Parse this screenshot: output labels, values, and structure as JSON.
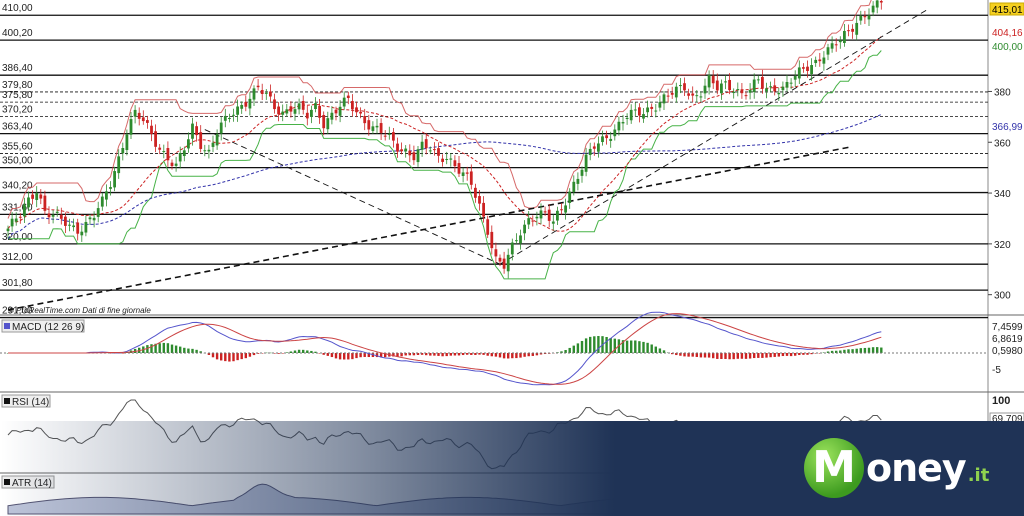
{
  "chart_data": {
    "type": "candlestick",
    "watermark": "© ProRealTime.com Dati di fine giornale",
    "colors": {
      "up": "#2e8b2e",
      "down": "#cc2222",
      "sma_short": "#cc2222",
      "sma_long": "#3333aa",
      "stop_red": "#cc4444",
      "stop_green": "#33aa33",
      "macd": "#5555cc",
      "macd_signal": "#cc4444",
      "rsi": "#555555",
      "atr": "#444466"
    },
    "price_axis": {
      "ticks": [
        300,
        320,
        340,
        360,
        380
      ],
      "range": [
        292,
        416
      ]
    },
    "support_resistance_levels": [
      {
        "value": "410,00",
        "style": "solid"
      },
      {
        "value": "400,20",
        "style": "solid"
      },
      {
        "value": "386,40",
        "style": "solid"
      },
      {
        "value": "379,80",
        "style": "dashed"
      },
      {
        "value": "375,80",
        "style": "dashed"
      },
      {
        "value": "370,20",
        "style": "dashed"
      },
      {
        "value": "363,40",
        "style": "solid"
      },
      {
        "value": "355,60",
        "style": "dashed"
      },
      {
        "value": "350,00",
        "style": "solid"
      },
      {
        "value": "340,20",
        "style": "solid"
      },
      {
        "value": "331,60",
        "style": "solid"
      },
      {
        "value": "320,00",
        "style": "solid"
      },
      {
        "value": "312,00",
        "style": "solid"
      },
      {
        "value": "301,80",
        "style": "solid"
      },
      {
        "value": "291,00",
        "style": "solid"
      }
    ],
    "right_tags": [
      {
        "text": "415,01",
        "color": "#000000",
        "bg": "#f5d020"
      },
      {
        "text": "404,16",
        "color": "#cc2222",
        "bg": "#ffffff"
      },
      {
        "text": "400,00",
        "color": "#2e8b2e",
        "bg": "#ffffff"
      },
      {
        "text": "366,99",
        "color": "#3333aa",
        "bg": "#ffffff"
      }
    ],
    "close_anchors": [
      [
        0,
        326
      ],
      [
        3,
        331
      ],
      [
        5,
        337
      ],
      [
        7,
        342
      ],
      [
        9,
        333
      ],
      [
        12,
        330
      ],
      [
        15,
        327
      ],
      [
        17,
        326
      ],
      [
        19,
        328
      ],
      [
        21,
        331
      ],
      [
        23,
        336
      ],
      [
        25,
        344
      ],
      [
        27,
        354
      ],
      [
        29,
        365
      ],
      [
        31,
        371
      ],
      [
        33,
        368
      ],
      [
        35,
        363
      ],
      [
        37,
        358
      ],
      [
        39,
        354
      ],
      [
        41,
        350
      ],
      [
        43,
        357
      ],
      [
        45,
        366
      ],
      [
        47,
        360
      ],
      [
        49,
        356
      ],
      [
        51,
        364
      ],
      [
        53,
        368
      ],
      [
        55,
        372
      ],
      [
        57,
        375
      ],
      [
        59,
        378
      ],
      [
        61,
        381
      ],
      [
        63,
        378
      ],
      [
        65,
        374
      ],
      [
        67,
        372
      ],
      [
        69,
        374
      ],
      [
        71,
        373
      ],
      [
        73,
        370
      ],
      [
        75,
        374
      ],
      [
        77,
        368
      ],
      [
        79,
        371
      ],
      [
        81,
        374
      ],
      [
        83,
        376
      ],
      [
        85,
        372
      ],
      [
        87,
        369
      ],
      [
        89,
        366
      ],
      [
        91,
        364
      ],
      [
        93,
        361
      ],
      [
        95,
        358
      ],
      [
        97,
        357
      ],
      [
        99,
        355
      ],
      [
        101,
        358
      ],
      [
        103,
        357
      ],
      [
        105,
        354
      ],
      [
        107,
        355
      ],
      [
        109,
        351
      ],
      [
        111,
        347
      ],
      [
        113,
        343
      ],
      [
        115,
        335
      ],
      [
        117,
        326
      ],
      [
        119,
        314
      ],
      [
        121,
        311
      ],
      [
        123,
        318
      ],
      [
        125,
        325
      ],
      [
        127,
        330
      ],
      [
        129,
        332
      ],
      [
        131,
        331
      ],
      [
        133,
        328
      ],
      [
        135,
        334
      ],
      [
        137,
        341
      ],
      [
        139,
        347
      ],
      [
        141,
        353
      ],
      [
        143,
        358
      ],
      [
        145,
        361
      ],
      [
        147,
        364
      ],
      [
        149,
        367
      ],
      [
        151,
        370
      ],
      [
        153,
        371
      ],
      [
        155,
        372
      ],
      [
        157,
        374
      ],
      [
        159,
        376
      ],
      [
        161,
        378
      ],
      [
        163,
        380
      ],
      [
        165,
        382
      ],
      [
        167,
        378
      ],
      [
        169,
        380
      ],
      [
        171,
        384
      ],
      [
        173,
        381
      ],
      [
        175,
        383
      ],
      [
        177,
        382
      ],
      [
        179,
        379
      ],
      [
        181,
        380
      ],
      [
        183,
        384
      ],
      [
        185,
        381
      ],
      [
        187,
        382
      ],
      [
        189,
        381
      ],
      [
        191,
        384
      ],
      [
        193,
        387
      ],
      [
        195,
        390
      ],
      [
        197,
        392
      ],
      [
        199,
        395
      ],
      [
        201,
        397
      ],
      [
        203,
        400
      ],
      [
        205,
        404
      ],
      [
        207,
        408
      ],
      [
        209,
        410
      ],
      [
        211,
        412
      ],
      [
        213,
        415.01
      ]
    ],
    "trend_lines": [
      {
        "from": [
          0,
          294
        ],
        "to": [
          205,
          358
        ],
        "style": "dashed"
      },
      {
        "from": [
          48,
          365
        ],
        "to": [
          120,
          312
        ],
        "style": "dashed"
      },
      {
        "from": [
          120,
          312
        ],
        "to": [
          224,
          412
        ],
        "style": "dashed"
      }
    ],
    "indicators": [
      {
        "name": "MACD (12 26 9)",
        "values": [
          "7,4599",
          "6,8619",
          "0,5980"
        ],
        "axis_ticks": [
          "-5"
        ]
      },
      {
        "name": "RSI (14)",
        "values": [
          "69,709"
        ],
        "axis_ticks": [
          "100"
        ]
      },
      {
        "name": "ATR (14)",
        "values": [],
        "axis_ticks": []
      }
    ]
  },
  "branding": {
    "logo_letter": "M",
    "logo_text": "oney",
    "logo_ext": ".it"
  }
}
